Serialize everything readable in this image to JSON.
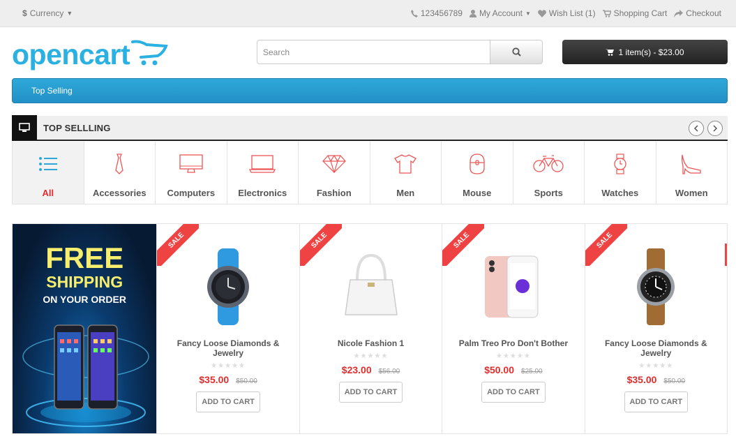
{
  "topbar": {
    "currency_label": "Currency",
    "currency_symbol": "$",
    "phone": "123456789",
    "my_account": "My Account",
    "wishlist": "Wish List (1)",
    "shopping_cart": "Shopping Cart",
    "checkout": "Checkout"
  },
  "header": {
    "logo_text": "opencart",
    "search_placeholder": "Search",
    "cart_summary": "1 item(s) - $23.00"
  },
  "menu": {
    "item": "Top Selling"
  },
  "section": {
    "title": "TOP SELLLING",
    "categories": [
      {
        "label": "All",
        "icon": "list-icon",
        "active": true
      },
      {
        "label": "Accessories",
        "icon": "tie-icon"
      },
      {
        "label": "Computers",
        "icon": "monitor-icon"
      },
      {
        "label": "Electronics",
        "icon": "laptop-icon"
      },
      {
        "label": "Fashion",
        "icon": "diamond-icon"
      },
      {
        "label": "Men",
        "icon": "tshirt-icon"
      },
      {
        "label": "Mouse",
        "icon": "mouse-icon"
      },
      {
        "label": "Sports",
        "icon": "bicycle-icon"
      },
      {
        "label": "Watches",
        "icon": "watch-icon"
      },
      {
        "label": "Women",
        "icon": "heel-shoe-icon"
      }
    ]
  },
  "banner": {
    "line1": "FREE",
    "line2": "SHIPPING",
    "line3": "ON YOUR ORDER"
  },
  "products": [
    {
      "badge": "SALE",
      "name": "Fancy Loose Diamonds & Jewelry",
      "price": "$35.00",
      "old_price": "$50.00",
      "button": "ADD TO CART",
      "image": "smartwatch-blue-strap"
    },
    {
      "badge": "SALE",
      "name": "Nicole Fashion 1",
      "price": "$23.00",
      "old_price": "$56.00",
      "button": "ADD TO CART",
      "image": "white-handbag"
    },
    {
      "badge": "SALE",
      "name": "Palm Treo Pro Don't Bother",
      "price": "$50.00",
      "old_price": "$25.00",
      "button": "ADD TO CART",
      "image": "rose-gold-iphone"
    },
    {
      "badge": "SALE",
      "name": "Fancy Loose Diamonds & Jewelry",
      "price": "$35.00",
      "old_price": "$50.00",
      "button": "ADD TO CART",
      "image": "leather-strap-watch"
    }
  ],
  "colors": {
    "accent": "#2bb1e1",
    "sale": "#ef4343",
    "price": "#e22d2d"
  }
}
